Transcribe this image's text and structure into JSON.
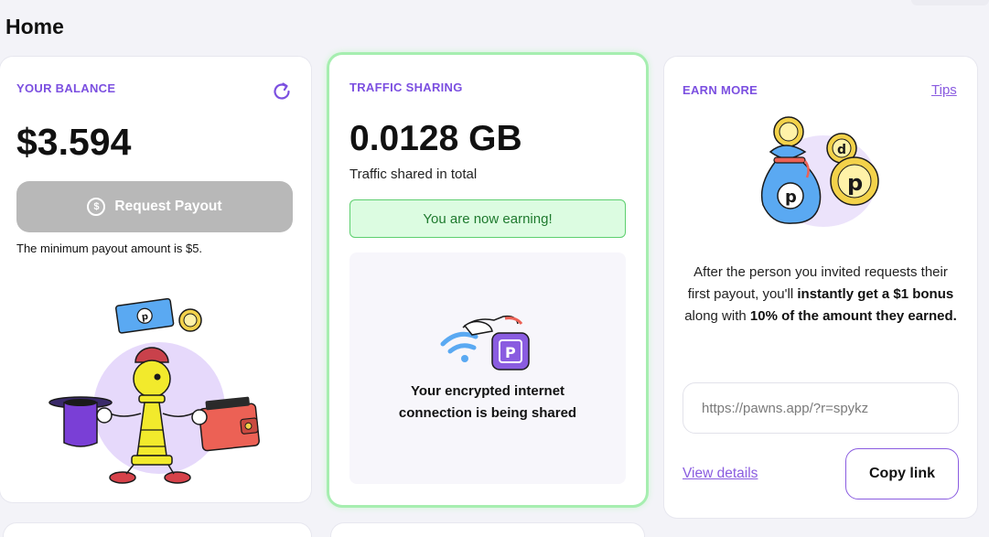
{
  "page": {
    "title": "Home"
  },
  "balance": {
    "title": "YOUR BALANCE",
    "value": "$3.594",
    "payout_label": "Request Payout",
    "payout_icon": "dollar-circle-icon",
    "min_text": "The minimum payout amount is $5."
  },
  "traffic": {
    "title": "TRAFFIC SHARING",
    "value": "0.0128 GB",
    "subtitle": "Traffic shared in total",
    "status": "You are now earning!",
    "share_line1": "Your encrypted internet",
    "share_line2": "connection is being shared"
  },
  "earn": {
    "title": "EARN MORE",
    "tips_label": "Tips",
    "desc_1": "After the person you invited requests their first payout, you'll ",
    "desc_bold_1": "instantly get a $1 bonus",
    "desc_2": " along with ",
    "desc_bold_2": "10% of the amount they earned.",
    "referral_link": "https://pawns.app/?r=spykz",
    "view_details_label": "View details",
    "copy_label": "Copy link"
  },
  "colors": {
    "accent": "#7b4fe0",
    "success_bg": "#dcfce1",
    "success_border": "#5dcf6f",
    "disabled_button": "#b8b8b8",
    "background": "#f3f3f8"
  }
}
